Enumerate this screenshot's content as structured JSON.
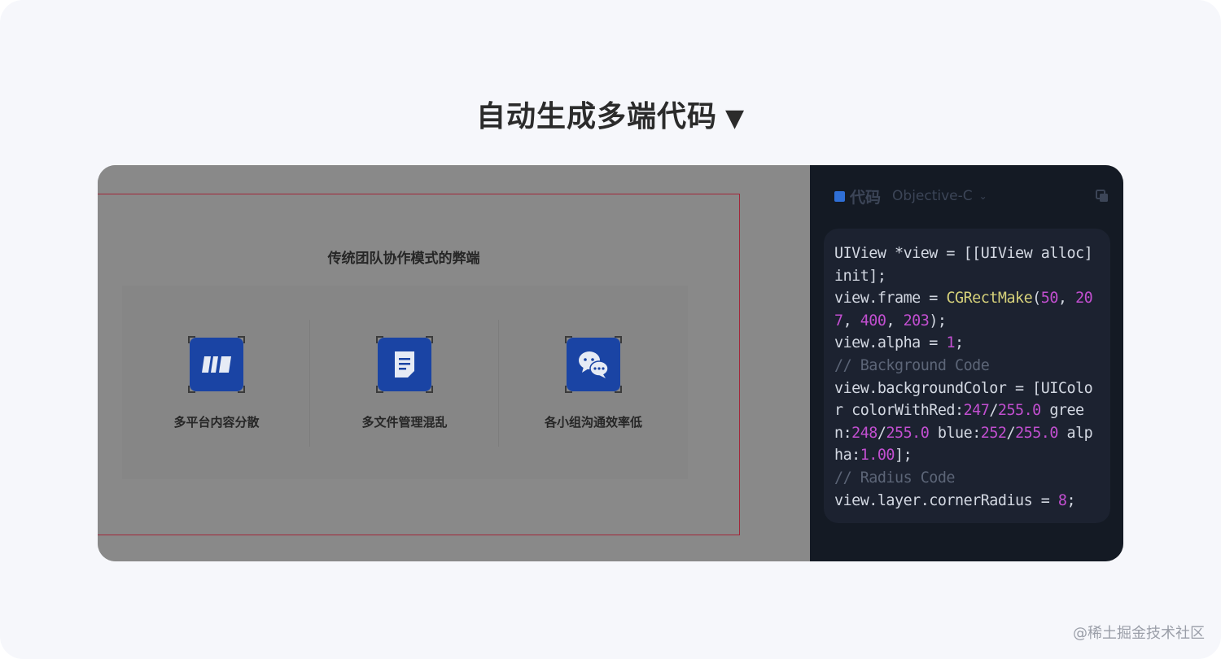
{
  "headline": {
    "text": "自动生成多端代码",
    "arrow": "▼"
  },
  "canvas": {
    "card_title": "传统团队协作模式的弊端",
    "items": [
      {
        "label": "多平台内容分散",
        "icon": "columns-icon"
      },
      {
        "label": "多文件管理混乱",
        "icon": "document-icon"
      },
      {
        "label": "各小组沟通效率低",
        "icon": "chat-bubbles-icon"
      }
    ],
    "icon_color": "#1a44a4",
    "selection_color": "#a2273a"
  },
  "code_panel": {
    "title": "代码",
    "language": "Objective-C",
    "chevron": "⌄",
    "lines": [
      [
        {
          "t": "UIView *view = [[UIView alloc]",
          "c": ""
        }
      ],
      [
        {
          "t": "init];",
          "c": ""
        }
      ],
      [
        {
          "t": "view.frame = ",
          "c": ""
        },
        {
          "t": "CGRectMake",
          "c": "fn"
        },
        {
          "t": "(",
          "c": ""
        },
        {
          "t": "50",
          "c": "num"
        },
        {
          "t": ", ",
          "c": ""
        },
        {
          "t": "20",
          "c": "num"
        }
      ],
      [
        {
          "t": "7",
          "c": "num"
        },
        {
          "t": ", ",
          "c": ""
        },
        {
          "t": "400",
          "c": "num"
        },
        {
          "t": ", ",
          "c": ""
        },
        {
          "t": "203",
          "c": "num"
        },
        {
          "t": ");",
          "c": ""
        }
      ],
      [
        {
          "t": "view.alpha = ",
          "c": ""
        },
        {
          "t": "1",
          "c": "num"
        },
        {
          "t": ";",
          "c": ""
        }
      ],
      [
        {
          "t": "// Background Code",
          "c": "cm"
        }
      ],
      [
        {
          "t": "view.backgroundColor = [UIColo",
          "c": ""
        }
      ],
      [
        {
          "t": "r colorWithRed:",
          "c": ""
        },
        {
          "t": "247",
          "c": "num"
        },
        {
          "t": "/",
          "c": ""
        },
        {
          "t": "255.0",
          "c": "num"
        },
        {
          "t": " gree",
          "c": ""
        }
      ],
      [
        {
          "t": "n:",
          "c": ""
        },
        {
          "t": "248",
          "c": "num"
        },
        {
          "t": "/",
          "c": ""
        },
        {
          "t": "255.0",
          "c": "num"
        },
        {
          "t": " blue:",
          "c": ""
        },
        {
          "t": "252",
          "c": "num"
        },
        {
          "t": "/",
          "c": ""
        },
        {
          "t": "255.0",
          "c": "num"
        },
        {
          "t": " alp",
          "c": ""
        }
      ],
      [
        {
          "t": "ha:",
          "c": ""
        },
        {
          "t": "1.00",
          "c": "num"
        },
        {
          "t": "];",
          "c": ""
        }
      ],
      [
        {
          "t": "// Radius Code",
          "c": "cm"
        }
      ],
      [
        {
          "t": "view.layer.cornerRadius = ",
          "c": ""
        },
        {
          "t": "8",
          "c": "num"
        },
        {
          "t": ";",
          "c": ""
        }
      ]
    ]
  },
  "watermark": "@稀土掘金技术社区"
}
